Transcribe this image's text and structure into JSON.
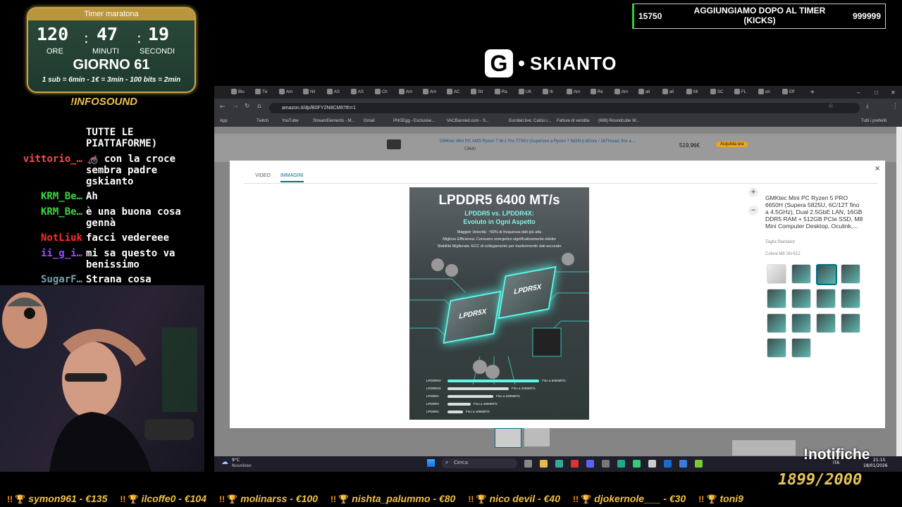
{
  "timer": {
    "header": "Timer maratona",
    "hours": "120",
    "minutes": "47",
    "seconds": "19",
    "hours_label": "ORE",
    "minutes_label": "MINUTI",
    "seconds_label": "SECONDI",
    "day": "GIORNO 61",
    "rates": "1 sub = 6min - 1€ = 3min - 100 bits = 2min"
  },
  "infosound": "!INFOSOUND",
  "chat": [
    {
      "user": "",
      "user_color": "#ffffff",
      "lines": [
        "TUTTE LE",
        "PIATTAFORME)"
      ]
    },
    {
      "user": "vittorio_…",
      "user_color": "#ff4b4b",
      "lines": [
        "🦽 con la croce",
        "sembra padre",
        "gskianto"
      ]
    },
    {
      "user": "KRM_Be…",
      "user_color": "#3ed63e",
      "lines": [
        "Ah"
      ]
    },
    {
      "user": "KRM_Be…",
      "user_color": "#3ed63e",
      "lines": [
        "è una buona cosa",
        "gennà"
      ]
    },
    {
      "user": "NotLiuk",
      "user_color": "#ff2b2b",
      "lines": [
        "facci vedereee"
      ]
    },
    {
      "user": "ii_g_i…",
      "user_color": "#9b4dff",
      "lines": [
        "mi sa questo va",
        "benissimo"
      ]
    },
    {
      "user": "SugarF…",
      "user_color": "#7aa0b0",
      "lines": [
        "Strana cosa"
      ]
    }
  ],
  "goal": {
    "current": "15750",
    "text": "AGGIUNGIAMO DOPO AL TIMER (KICKS)",
    "target": "999999"
  },
  "logo": {
    "letter": "G",
    "text": "SKIANTO"
  },
  "browser": {
    "tabs": [
      "Blu",
      "Tiv",
      "Am",
      "Nil",
      "AS",
      "AS",
      "Ch",
      "Am",
      "Am",
      "AC",
      "Str",
      "Ra",
      "UK",
      "Iti",
      "Am",
      "Re",
      "Am",
      "ali",
      "ali",
      "Mi",
      "SC",
      "FL",
      "ori",
      "Eff"
    ],
    "url": "amazon.it/dp/B0FY2N8CM6?th=1",
    "bookmarks": [
      "App",
      "Twitch",
      "YouTube",
      "StreamElements - M...",
      "Gmail",
      "PNGEgg - Exclusive...",
      "VACBanned.com - S...",
      "Eurobet.live: Calcio i...",
      "Fatture di vendita",
      "(688) Roundcube W..."
    ],
    "bookmarks_right": "Tutti i preferiti",
    "strip_title": "GMKtec Mini PC AMD Ryzen 7 W-1 Pro 7730U (Superiore a Ryzen 7 5825U) 8Core / 16Thread, fino a ...",
    "strip_rating": "(364)",
    "strip_price": "519,96€",
    "strip_button": "Acquista ora",
    "modal": {
      "tab_video": "VIDEO",
      "tab_images": "IMMAGINI",
      "close": "×",
      "image": {
        "headline": "LPDDR5 6400 MT/s",
        "sub1": "LPDDR5 vs. LPDDR4X:",
        "sub2": "Evoluto in Ogni Aspetto",
        "feat1": "Maggior Velocità: ~50% di frequenza dati più alta",
        "feat2": "Migliore Efficienza: Consumo energetico significativamente ridotto",
        "feat3": "Stabilità Migliorata: ECC di collegamento per trasferimento dati accurato",
        "chip1": "LPDR5X",
        "chip2": "LPDR5X",
        "bars": [
          {
            "label": "LPDDR5X",
            "value": "Fino a 6400MT/s",
            "fraction": 1.0
          },
          {
            "label": "LPDDR4X",
            "value": "Fino a 4266MT/s",
            "fraction": 0.67
          },
          {
            "label": "LPDDR4",
            "value": "Fino a 3200MT/s",
            "fraction": 0.5
          },
          {
            "label": "LPDDR3",
            "value": "Fino a 1600MT/s",
            "fraction": 0.25
          },
          {
            "label": "LPDDR2",
            "value": "Fino a 1066MT/s",
            "fraction": 0.17
          }
        ]
      },
      "product_title": "GMKtec Mini PC Ryzen 5 PRO 6650H (Supera 5825U, 6C/12T fino a 4.5GHz), Dual 2.5GbE LAN, 16GB DDR5 RAM + 512GB PCIe SSD, M8 Mini Computer Desktop, Oculink,...",
      "size": "Taglia:Standard",
      "color": "Colore:M8 16+512",
      "thumb_count": 14,
      "selected_thumb": 2
    },
    "taskbar": {
      "weather_temp": "9°C",
      "weather_desc": "Nuvoloso",
      "search": "Cerca",
      "lang": "ITA",
      "time": "21:15",
      "date": "18/01/2026"
    }
  },
  "notifiche": "!notifiche",
  "counter": "1899/2000",
  "ticker": [
    "symon961 - €135",
    "ilcoffe0 - €104",
    "molinarss - €100",
    "nishta_palummo - €80",
    "nico devil - €40",
    "djokernole___ - €30",
    "toni9"
  ]
}
